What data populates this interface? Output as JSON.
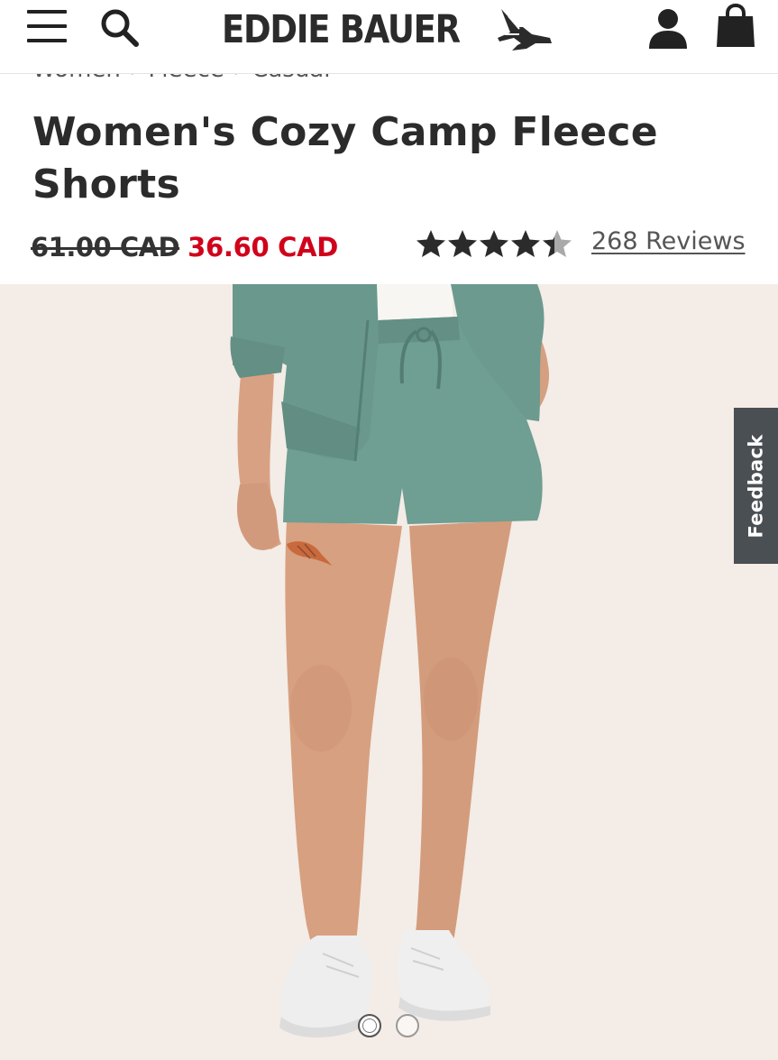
{
  "header": {
    "brand": "EDDIE BAUER",
    "icons": [
      "menu-icon",
      "search-icon",
      "bird-logo-icon",
      "account-icon",
      "shopping-bag-icon"
    ]
  },
  "breadcrumb": [
    "Women",
    "Fleece",
    "Casual"
  ],
  "product": {
    "title": "Women's Cozy Camp Fleece Shorts",
    "original_price": "61.00 CAD",
    "sale_price": "36.60 CAD",
    "rating": 4.4,
    "rating_max": 5,
    "reviews_label": "268 Reviews"
  },
  "gallery": {
    "image_count": 2,
    "active_index": 0
  },
  "feedback_label": "Feedback",
  "colors": {
    "sale_red": "#d0021b",
    "text_dark": "#2b2b2b",
    "image_background": "#f4ece6",
    "garment_sage": "#6f9e92",
    "feedback_tab": "#4a4f54"
  }
}
